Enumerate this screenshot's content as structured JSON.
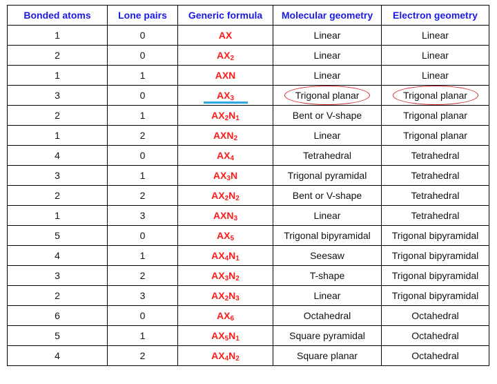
{
  "table": {
    "headers": [
      "Bonded atoms",
      "Lone pairs",
      "Generic formula",
      "Molecular geometry",
      "Electron geometry"
    ],
    "rows": [
      {
        "bonded": "1",
        "lone": "0",
        "formula": [
          [
            "AX",
            ""
          ]
        ],
        "molecular": "Linear",
        "electron": "Linear"
      },
      {
        "bonded": "2",
        "lone": "0",
        "formula": [
          [
            "AX",
            "2"
          ]
        ],
        "molecular": "Linear",
        "electron": "Linear"
      },
      {
        "bonded": "1",
        "lone": "1",
        "formula": [
          [
            "AXN",
            ""
          ]
        ],
        "molecular": "Linear",
        "electron": "Linear"
      },
      {
        "bonded": "3",
        "lone": "0",
        "formula": [
          [
            "AX",
            "3"
          ]
        ],
        "molecular": "Trigonal planar",
        "electron": "Trigonal planar",
        "highlighted": true
      },
      {
        "bonded": "2",
        "lone": "1",
        "formula": [
          [
            "AX",
            "2"
          ],
          [
            "N",
            "1"
          ]
        ],
        "molecular": "Bent or V-shape",
        "electron": "Trigonal planar"
      },
      {
        "bonded": "1",
        "lone": "2",
        "formula": [
          [
            "AXN",
            "2"
          ]
        ],
        "molecular": "Linear",
        "electron": "Trigonal planar"
      },
      {
        "bonded": "4",
        "lone": "0",
        "formula": [
          [
            "AX",
            "4"
          ]
        ],
        "molecular": "Tetrahedral",
        "electron": "Tetrahedral"
      },
      {
        "bonded": "3",
        "lone": "1",
        "formula": [
          [
            "AX",
            "3"
          ],
          [
            "N",
            ""
          ]
        ],
        "molecular": "Trigonal pyramidal",
        "electron": "Tetrahedral"
      },
      {
        "bonded": "2",
        "lone": "2",
        "formula": [
          [
            "AX",
            "2"
          ],
          [
            "N",
            "2"
          ]
        ],
        "molecular": "Bent or V-shape",
        "electron": "Tetrahedral"
      },
      {
        "bonded": "1",
        "lone": "3",
        "formula": [
          [
            "AXN",
            "3"
          ]
        ],
        "molecular": "Linear",
        "electron": "Tetrahedral"
      },
      {
        "bonded": "5",
        "lone": "0",
        "formula": [
          [
            "AX",
            "5"
          ]
        ],
        "molecular": "Trigonal bipyramidal",
        "electron": "Trigonal bipyramidal"
      },
      {
        "bonded": "4",
        "lone": "1",
        "formula": [
          [
            "AX",
            "4"
          ],
          [
            "N",
            "1"
          ]
        ],
        "molecular": "Seesaw",
        "electron": "Trigonal bipyramidal"
      },
      {
        "bonded": "3",
        "lone": "2",
        "formula": [
          [
            "AX",
            "3"
          ],
          [
            "N",
            "2"
          ]
        ],
        "molecular": "T-shape",
        "electron": "Trigonal bipyramidal"
      },
      {
        "bonded": "2",
        "lone": "3",
        "formula": [
          [
            "AX",
            "2"
          ],
          [
            "N",
            "3"
          ]
        ],
        "molecular": "Linear",
        "electron": "Trigonal bipyramidal"
      },
      {
        "bonded": "6",
        "lone": "0",
        "formula": [
          [
            "AX",
            "6"
          ]
        ],
        "molecular": "Octahedral",
        "electron": "Octahedral"
      },
      {
        "bonded": "5",
        "lone": "1",
        "formula": [
          [
            "AX",
            "5"
          ],
          [
            "N",
            "1"
          ]
        ],
        "molecular": "Square pyramidal",
        "electron": "Octahedral"
      },
      {
        "bonded": "4",
        "lone": "2",
        "formula": [
          [
            "AX",
            "4"
          ],
          [
            "N",
            "2"
          ]
        ],
        "molecular": "Square planar",
        "electron": "Octahedral"
      }
    ]
  },
  "colors": {
    "header_text": "#1a1ae6",
    "formula_text": "#ff1a1a",
    "highlight_circle": "#d0262b",
    "highlight_underline": "#2aa7e0"
  }
}
